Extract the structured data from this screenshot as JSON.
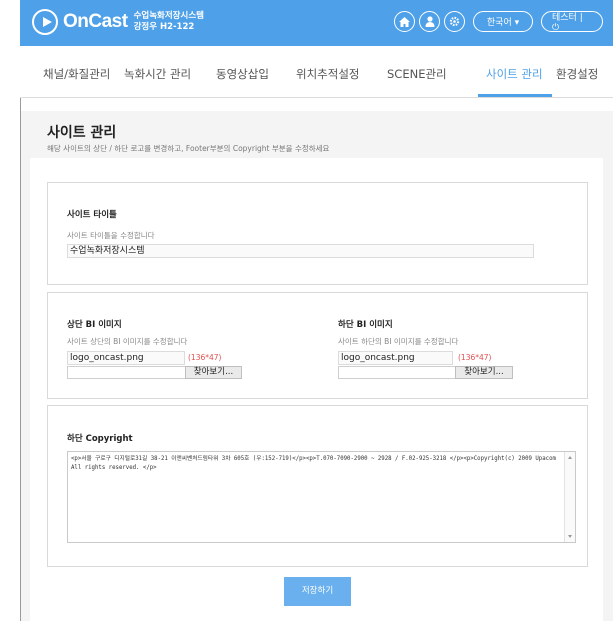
{
  "header": {
    "brand": "OnCast",
    "system_name": "수업녹화저장시스템",
    "location": "강정우 H2-122",
    "lang_label": "한국어 ▾",
    "user_label": "테스터 | ⏻"
  },
  "nav": {
    "items": [
      {
        "label": "채널/화질관리"
      },
      {
        "label": "녹화시간 관리"
      },
      {
        "label": "동영상삽입"
      },
      {
        "label": "위치추적설정"
      },
      {
        "label": "SCENE관리"
      },
      {
        "label": "사이트 관리"
      },
      {
        "label": "환경설정"
      }
    ],
    "active": "사이트 관리"
  },
  "page": {
    "title": "사이트 관리",
    "description": "해당 사이트의 상단 / 하단 로고를 변경하고, Footer부분의 Copyright 부분을 수정하세요"
  },
  "site_title": {
    "label": "사이트 타이틀",
    "hint": "사이트 타이틀을 수정합니다",
    "value": "수업녹화저장시스템"
  },
  "top_bi": {
    "label": "상단 BI 이미지",
    "hint": "사이트 상단의 BI 이미지를 수정합니다",
    "filename": "logo_oncast.png",
    "dimension": "(136*47)",
    "browse": "찾아보기..."
  },
  "bottom_bi": {
    "label": "하단 BI 이미지",
    "hint": "사이트 하단의 BI 이미지를 수정합니다",
    "filename": "logo_oncast.png",
    "dimension": "(136*47)",
    "browse": "찾아보기..."
  },
  "copyright": {
    "label": "하단 Copyright",
    "value": "<p>서울 구로구 디지털로31길 38-21 이앤씨벤처드림타워 3차 605호 (우:152-719)</p><p>T.070-7090-2900 ~ 2928 / F.02-925-3218 </p><p>Copyright(c) 2009 Upacom All rights reserved. </p>"
  },
  "actions": {
    "save_label": "저장하기"
  },
  "colors": {
    "accent": "#4ea0e8",
    "note": "#e05050"
  }
}
